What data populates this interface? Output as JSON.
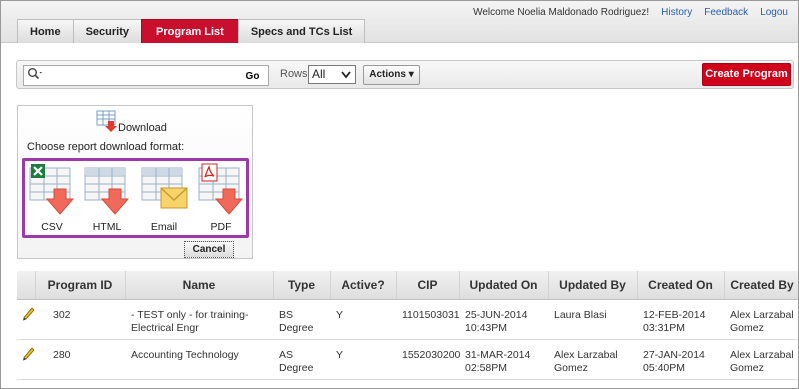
{
  "header": {
    "tabs": [
      {
        "label": "Home",
        "active": false
      },
      {
        "label": "Security",
        "active": false
      },
      {
        "label": "Program List",
        "active": true
      },
      {
        "label": "Specs and TCs List",
        "active": false
      }
    ],
    "welcome": "Welcome Noelia Maldonado Rodriguez!",
    "links": [
      "History",
      "Feedback",
      "Logou"
    ]
  },
  "toolbar": {
    "search_icon": "search-icon",
    "search_value": "",
    "go_label": "Go",
    "rows_label": "Rows",
    "rows_value": "All",
    "actions_label": "Actions ▾",
    "create_label": "Create Program",
    "accent": "#d0021b"
  },
  "download": {
    "title": "Download",
    "prompt": "Choose report download format:",
    "formats": [
      {
        "label": "CSV",
        "icon": "csv-download-icon"
      },
      {
        "label": "HTML",
        "icon": "html-download-icon"
      },
      {
        "label": "Email",
        "icon": "email-icon"
      },
      {
        "label": "PDF",
        "icon": "pdf-download-icon"
      }
    ],
    "cancel_label": "Cancel",
    "highlight": "#9b3aa8"
  },
  "table": {
    "columns": [
      "",
      "Program ID",
      "Name",
      "Type",
      "Active?",
      "CIP",
      "Updated On",
      "Updated By",
      "Created On",
      "Created By"
    ],
    "rows": [
      {
        "id": "302",
        "name": "- TEST only - for training-Electrical Engr",
        "type": "BS Degree",
        "active": "Y",
        "cip": "1101503031",
        "updated_on": "25-JUN-2014 10:43PM",
        "updated_by": "Laura Blasi",
        "created_on": "12-FEB-2014 03:31PM",
        "created_by": "Alex Larzabal Gomez"
      },
      {
        "id": "280",
        "name": "Accounting Technology",
        "type": "AS Degree",
        "active": "Y",
        "cip": "1552030200",
        "updated_on": "31-MAR-2014 02:58PM",
        "updated_by": "Alex Larzabal Gomez",
        "created_on": "27-JAN-2014 05:40PM",
        "created_by": "Alex Larzabal Gomez"
      }
    ]
  }
}
